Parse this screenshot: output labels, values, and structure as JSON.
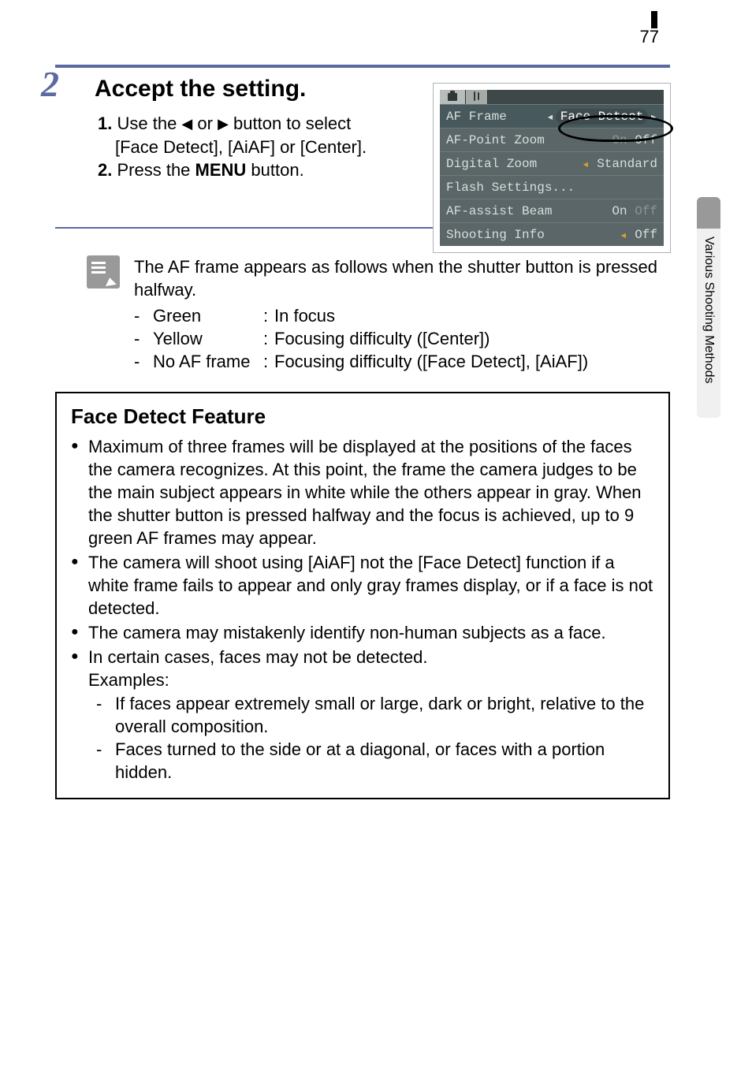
{
  "page_number": "77",
  "side_tab": "Various Shooting Methods",
  "step": {
    "number": "2",
    "title": "Accept the setting.",
    "line1_num": "1.",
    "line1_a": "Use the ",
    "line1_b": " or ",
    "line1_c": " button to select",
    "line1_row2": "[Face Detect], [AiAF] or [Center].",
    "line2_num": "2.",
    "line2_a": "Press the ",
    "line2_menu": "MENU",
    "line2_b": " button."
  },
  "menu": {
    "af_frame_lbl": "AF Frame",
    "af_frame_val": "Face Detect",
    "af_point_lbl": "AF-Point Zoom",
    "af_point_on": "On",
    "af_point_off": "Off",
    "dz_lbl": "Digital Zoom",
    "dz_val": "Standard",
    "flash_lbl": "Flash Settings...",
    "beam_lbl": "AF-assist Beam",
    "beam_on": "On",
    "beam_off": "Off",
    "info_lbl": "Shooting Info",
    "info_val": "Off"
  },
  "note": {
    "intro": "The AF frame appears as follows when the shutter button is pressed halfway.",
    "r1c1": "Green",
    "r1c2": "In focus",
    "r2c1": "Yellow",
    "r2c2": "Focusing difficulty ([Center])",
    "r3c1": "No AF frame",
    "r3c2": "Focusing difficulty ([Face Detect], [AiAF])"
  },
  "feature": {
    "title": "Face Detect Feature",
    "b1": "Maximum of three frames will be displayed at the positions of the faces the camera recognizes. At this point, the frame the camera judges to be the main subject appears in white while the others appear in gray. When the shutter button is pressed halfway and the focus is achieved, up to 9 green AF frames may appear.",
    "b2": "The camera will shoot using [AiAF] not the [Face Detect] function if a white frame fails to appear and only gray frames display, or if a face is not detected.",
    "b3": "The camera may mistakenly identify non-human subjects as a face.",
    "b4a": "In certain cases, faces may not be detected.",
    "b4b": "Examples:",
    "s1": "If faces appear extremely small or large, dark or bright, relative to the overall composition.",
    "s2": "Faces turned to the side or at a diagonal, or faces with a portion hidden."
  }
}
